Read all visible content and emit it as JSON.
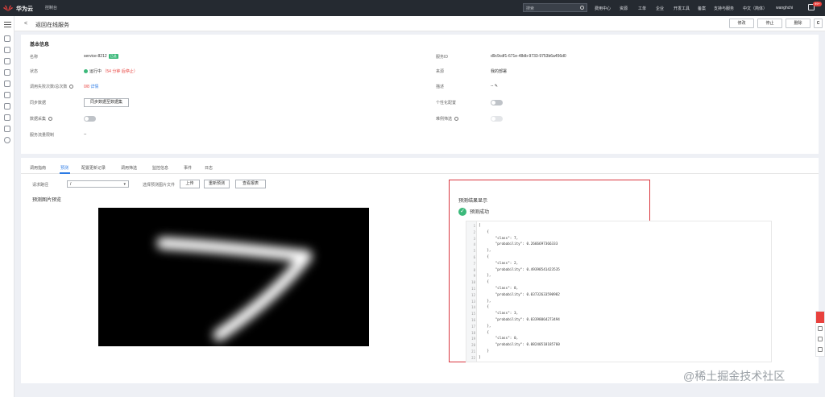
{
  "topbar": {
    "brand": "华为云",
    "console": "控制台",
    "search_placeholder": "搜索",
    "nav": [
      "费用中心",
      "资源",
      "工单",
      "企业",
      "开发工具",
      "备案",
      "支持与服务",
      "中文（简体）",
      "wanghchi"
    ],
    "badge": "99+"
  },
  "header": {
    "back": "<",
    "title": "返回在线服务",
    "buttons": [
      "修改",
      "停止",
      "删除"
    ],
    "refresh": "C"
  },
  "basic": {
    "section_title": "基本信息",
    "name_label": "名称",
    "name_value": "service-8212",
    "name_tag": "已选",
    "status_label": "状态",
    "status_value": "运行中",
    "status_note": "（54 分钟 后停止）",
    "calls_label": "调用失败次数/总次数",
    "calls_value": "0/8",
    "calls_link": "详情",
    "sync_label": "同步数据",
    "sync_button": "同步数据至数据集",
    "collect_label": "数据采集",
    "inc_label": "服务流量限制",
    "inc_value": "--",
    "id_label": "服务ID",
    "id_value": "d9c9cdf1-671e-48db-9733-9753b6a456d0",
    "source_label": "来源",
    "source_value": "我的部署",
    "desc_label": "描述",
    "desc_value": "--",
    "personal_label": "个性化配置",
    "sample_label": "难例筛选"
  },
  "tabs": [
    "调用指南",
    "预测",
    "配置更新记录",
    "调用筛选",
    "监控信息",
    "事件",
    "日志"
  ],
  "predict": {
    "path_label": "请求路径",
    "path_value": "/",
    "file_label": "选择预测图片文件",
    "buttons": [
      "上传",
      "重新预测",
      "查看报表"
    ],
    "preview_title": "预测图片预览",
    "result_title": "预测结果显示",
    "success": "预测成功"
  },
  "code_lines": [
    "[",
    "    {",
    "        \"class\": 7,",
    "        \"probability\": 0.2666697366333",
    "    },",
    "    {",
    "        \"class\": 2,",
    "        \"probability\": 0.49398541423535",
    "    },",
    "    {",
    "        \"class\": 8,",
    "        \"probability\": 0.03732633590982",
    "    },",
    "    {",
    "        \"class\": 3,",
    "        \"probability\": 0.03398064273494",
    "    },",
    "    {",
    "        \"class\": 0,",
    "        \"probability\": 0.08240518185760",
    "    }",
    "]"
  ],
  "watermark": "@稀土掘金技术社区",
  "colors": {
    "accent": "#2c7be5",
    "success": "#3bb97a",
    "danger": "#e8413d",
    "topbar": "#252a31"
  }
}
